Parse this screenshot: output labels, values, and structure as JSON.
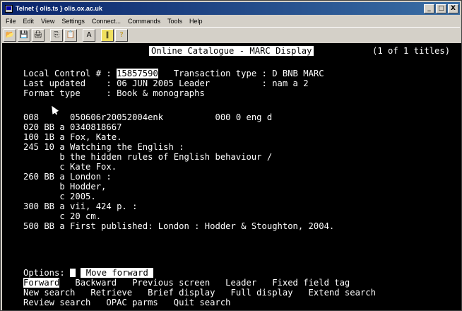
{
  "window": {
    "title": "Telnet { olis.ts } olis.ox.ac.uk",
    "min_label": "_",
    "max_label": "□",
    "close_label": "X"
  },
  "menu": [
    "File",
    "Edit",
    "View",
    "Settings",
    "Connect...",
    "Commands",
    "Tools",
    "Help"
  ],
  "toolbar": {
    "icons": [
      "open-icon",
      "save-icon",
      "print-icon",
      "copy-icon",
      "paste-icon",
      "font-icon",
      "pause-icon",
      "help-icon"
    ],
    "glyphs": [
      "📂",
      "💾",
      "🖨",
      "⎘",
      "📋",
      "A",
      "‖",
      "?"
    ]
  },
  "terminal": {
    "header_title": "Online Catalogue - MARC Display",
    "header_count": "(1 of 1 titles)",
    "local_control_label": "Local Control # : ",
    "local_control_value": "15857590",
    "transaction_text": "   Transaction type : D BNB MARC",
    "last_updated": "Last updated    : 06 JUN 2005 Leader          : nam a 2",
    "format_type": "Format type     : Book & monographs",
    "records": [
      "008      050606r20052004enk          000 0 eng d",
      "020 BB a 0340818667",
      "100 1B a Fox, Kate.",
      "245 10 a Watching the English :",
      "       b the hidden rules of English behaviour /",
      "       c Kate Fox.",
      "260 BB a London :",
      "       b Hodder,",
      "       c 2005.",
      "300 BB a vii, 424 p. :",
      "       c 20 cm.",
      "500 BB a First published: London : Hodder & Stoughton, 2004."
    ],
    "options_label": "Options: ",
    "options_message": " Move forward ",
    "commands_row1": {
      "selected": "Forward",
      "rest": "   Backward   Previous screen   Leader   Fixed field tag"
    },
    "commands_row2": "New search   Retrieve   Brief display   Full display   Extend search",
    "commands_row3": "Review search   OPAC parms   Quit search"
  }
}
